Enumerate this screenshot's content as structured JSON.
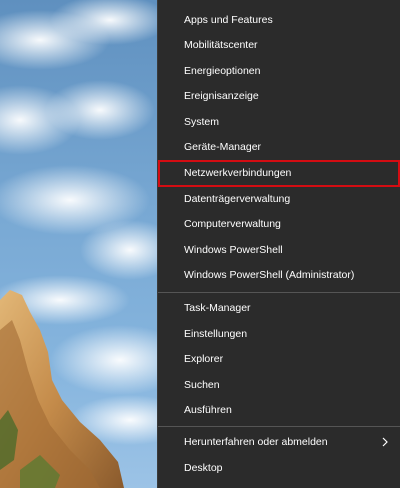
{
  "menu": {
    "items": [
      {
        "label": "Apps und Features"
      },
      {
        "label": "Mobilitätscenter"
      },
      {
        "label": "Energieoptionen"
      },
      {
        "label": "Ereignisanzeige"
      },
      {
        "label": "System"
      },
      {
        "label": "Geräte-Manager"
      },
      {
        "label": "Netzwerkverbindungen"
      },
      {
        "label": "Datenträgerverwaltung"
      },
      {
        "label": "Computerverwaltung"
      },
      {
        "label": "Windows PowerShell"
      },
      {
        "label": "Windows PowerShell (Administrator)"
      },
      {
        "label": "Task-Manager"
      },
      {
        "label": "Einstellungen"
      },
      {
        "label": "Explorer"
      },
      {
        "label": "Suchen"
      },
      {
        "label": "Ausführen"
      },
      {
        "label": "Herunterfahren oder abmelden"
      },
      {
        "label": "Desktop"
      }
    ],
    "highlight_color": "#d40c12",
    "background_color": "#2b2b2b"
  }
}
